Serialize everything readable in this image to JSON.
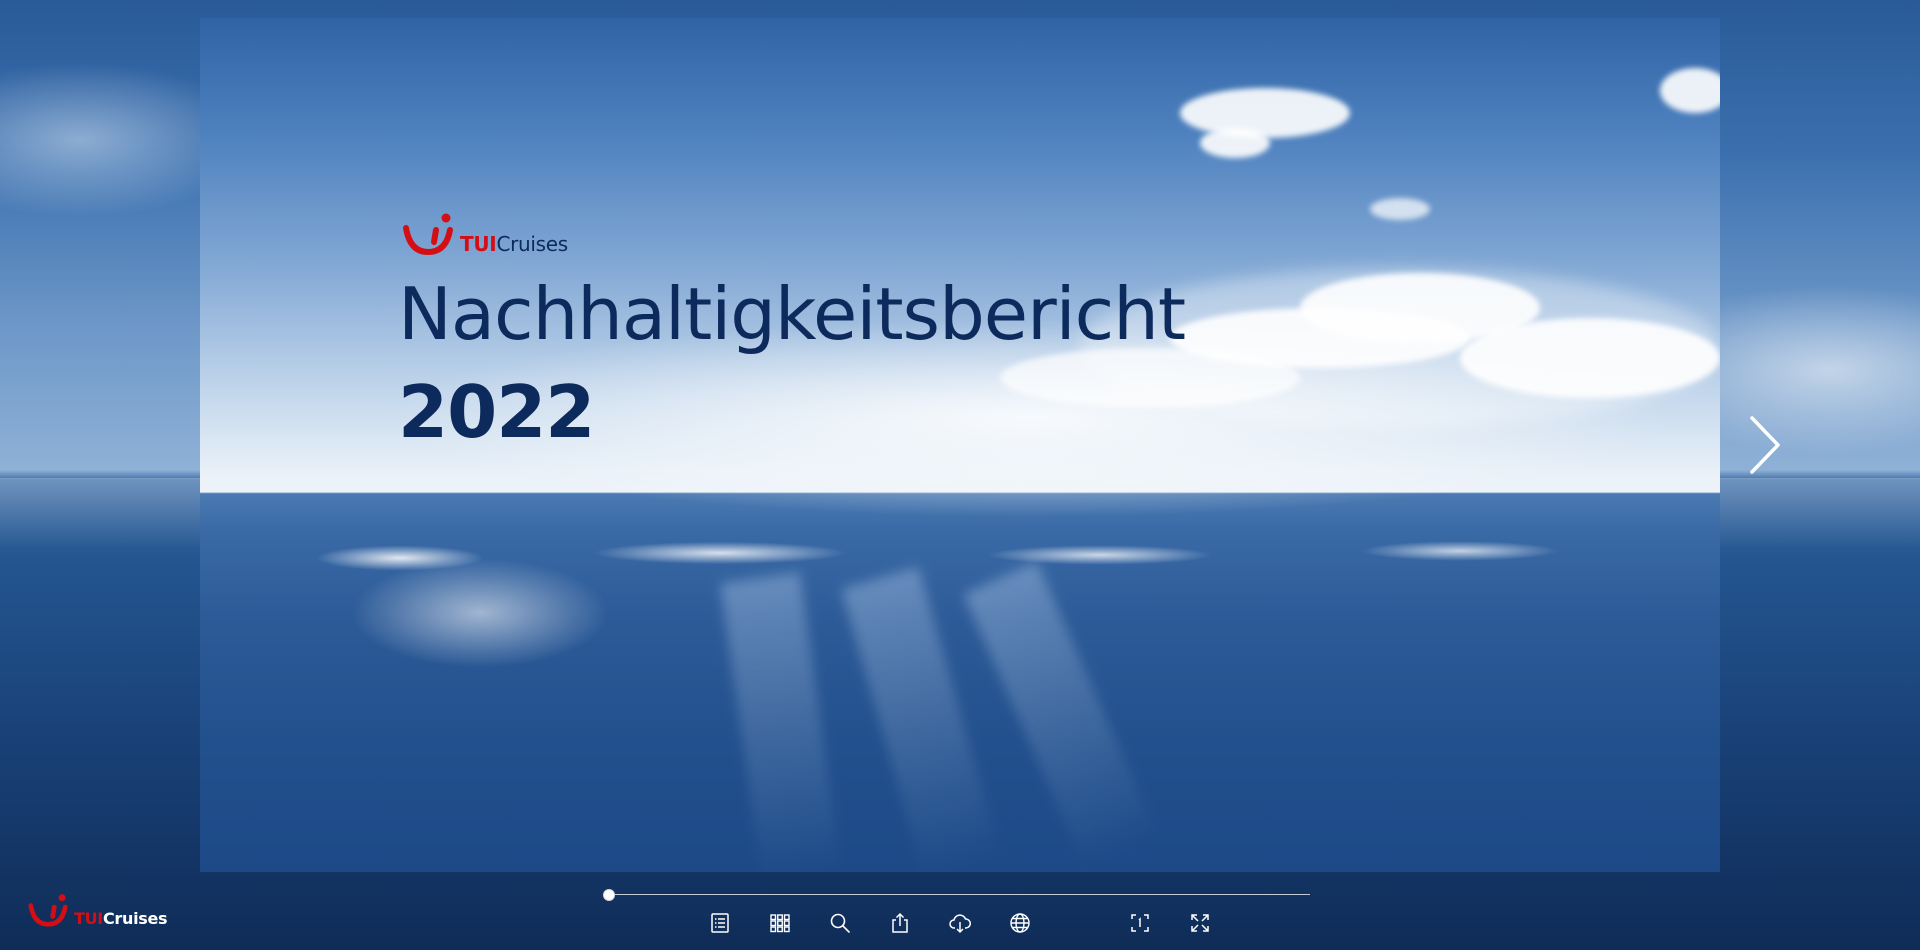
{
  "document": {
    "title": "Nachhaltigkeitsbericht",
    "year": "2022"
  },
  "brand": {
    "tui": "TUI",
    "cruises": "Cruises",
    "accent_color": "#d40e14",
    "navy_color": "#0d2a5c"
  },
  "footer_brand": {
    "tui": "TUI",
    "cruises": "Cruises"
  },
  "navigation": {
    "next_icon": "chevron-right-icon"
  },
  "progress": {
    "value": 0
  },
  "toolbar": {
    "items": [
      {
        "name": "table-of-contents",
        "icon": "list-icon"
      },
      {
        "name": "thumbnails",
        "icon": "grid-icon"
      },
      {
        "name": "search",
        "icon": "search-icon"
      },
      {
        "name": "share",
        "icon": "share-icon"
      },
      {
        "name": "download",
        "icon": "cloud-download-icon"
      },
      {
        "name": "language",
        "icon": "globe-icon"
      },
      {
        "name": "fit-page",
        "icon": "fit-screen-icon"
      },
      {
        "name": "fullscreen",
        "icon": "fullscreen-icon"
      }
    ]
  }
}
